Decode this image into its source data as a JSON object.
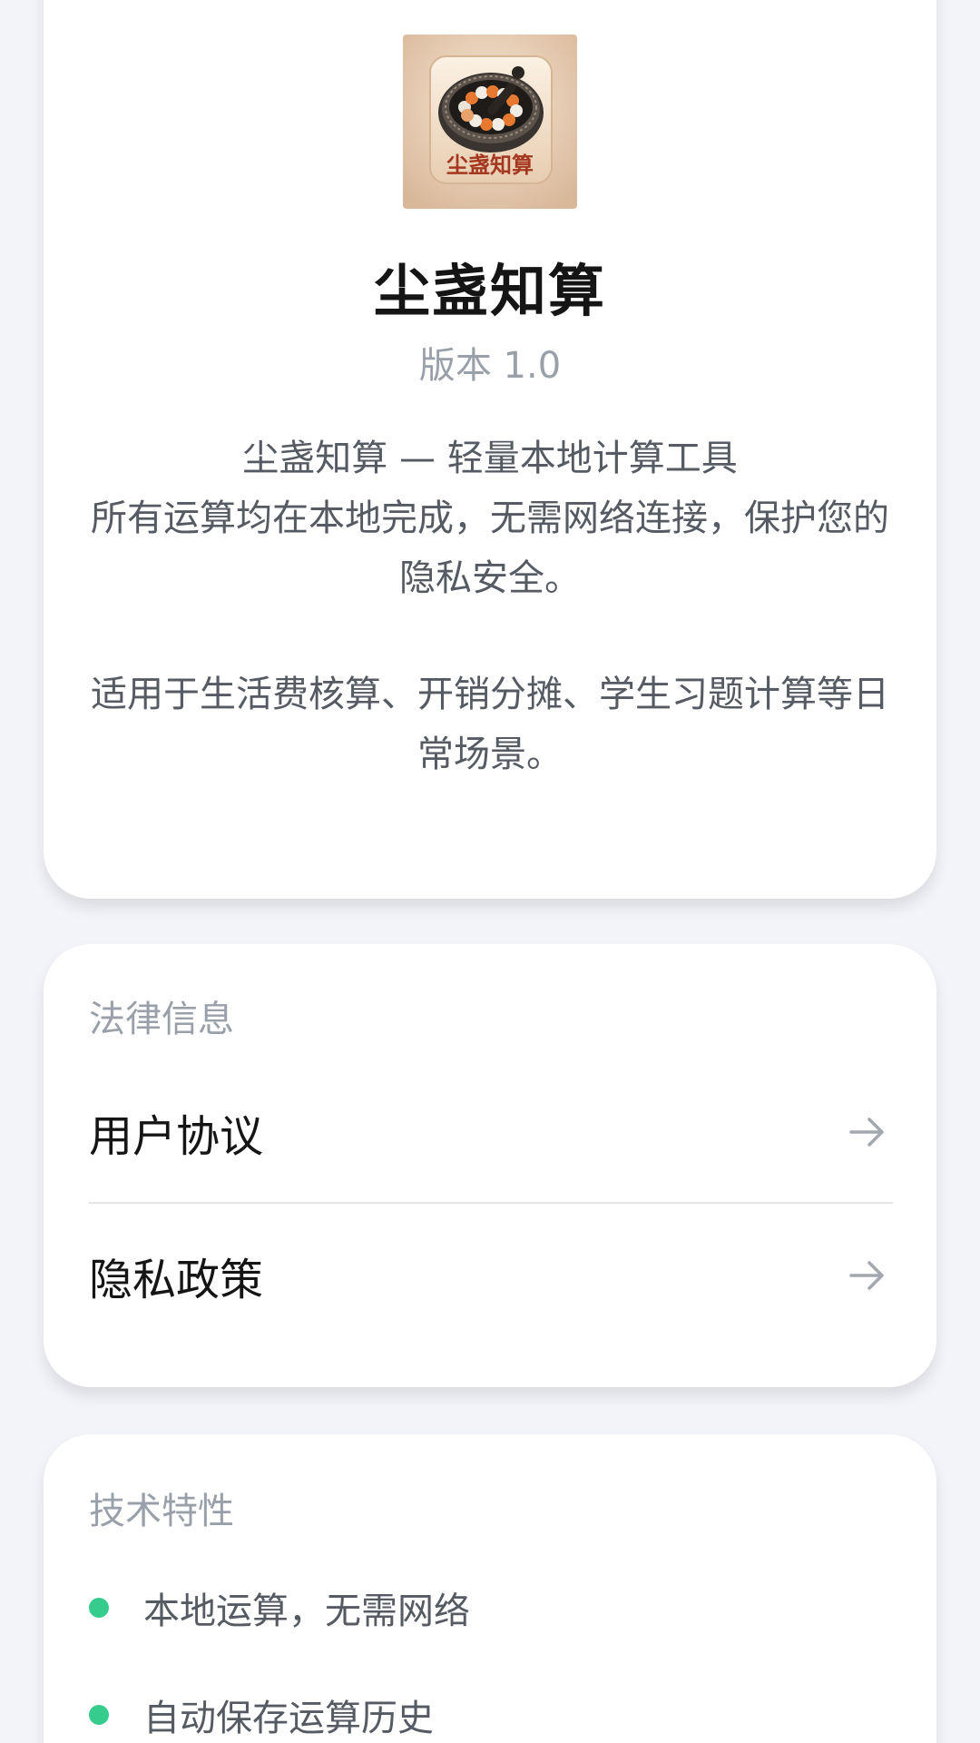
{
  "about": {
    "icon": "mortar-beads-app-icon",
    "icon_text": "尘盏知算",
    "app_name": "尘盏知算",
    "version": "版本 1.0",
    "tagline": "尘盏知算 — 轻量本地计算工具",
    "description_1": "所有运算均在本地完成，无需网络连接，保护您的隐私安全。",
    "description_2": "适用于生活费核算、开销分摊、学生习题计算等日常场景。"
  },
  "legal": {
    "title": "法律信息",
    "items": [
      {
        "label": "用户协议",
        "icon": "arrow-right-icon"
      },
      {
        "label": "隐私政策",
        "icon": "arrow-right-icon"
      }
    ]
  },
  "tech": {
    "title": "技术特性",
    "features": [
      {
        "text": "本地运算，无需网络"
      },
      {
        "text": "自动保存运算历史"
      }
    ]
  },
  "colors": {
    "background": "#f3f4f9",
    "card": "#ffffff",
    "accent_green": "#35cc8e",
    "text_primary": "#151515",
    "text_secondary": "#555a63",
    "text_muted": "#9aa0aa"
  }
}
